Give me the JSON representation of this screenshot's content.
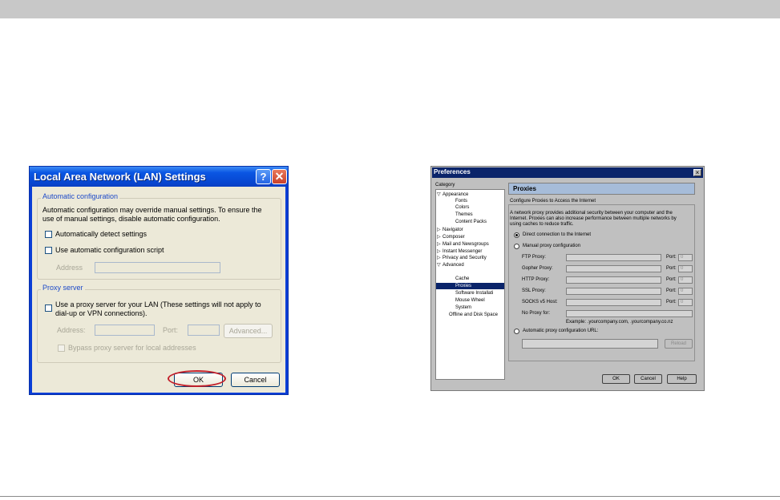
{
  "lan_dialog": {
    "title": "Local Area Network (LAN) Settings",
    "help_glyph": "?",
    "close_glyph": "✕",
    "auto_config": {
      "legend": "Automatic configuration",
      "description_line1": "Automatic configuration may override manual settings.  To ensure the",
      "description_line2": "use of manual settings, disable automatic configuration.",
      "auto_detect_label": "Automatically detect settings",
      "auto_script_label": "Use automatic configuration script",
      "address_label": "Address"
    },
    "proxy": {
      "legend": "Proxy server",
      "use_proxy_line1": "Use a proxy server for your LAN (These settings will not apply to",
      "use_proxy_line2": "dial-up or VPN connections).",
      "address_label": "Address:",
      "port_label": "Port:",
      "advanced_label": "Advanced...",
      "bypass_label": "Bypass proxy server for local addresses"
    },
    "ok_label": "OK",
    "cancel_label": "Cancel"
  },
  "prefs_dialog": {
    "title": "Preferences",
    "close_glyph": "×",
    "category_label": "Category",
    "tree": [
      {
        "label": "Appearance",
        "marker": "▽"
      },
      {
        "label": "Fonts"
      },
      {
        "label": "Colors"
      },
      {
        "label": "Themes"
      },
      {
        "label": "Content Packs"
      },
      {
        "label": "Navigator",
        "marker": "▷"
      },
      {
        "label": "Composer",
        "marker": "▷"
      },
      {
        "label": "Mail and Newsgroups",
        "marker": "▷"
      },
      {
        "label": "Instant Messenger",
        "marker": "▷"
      },
      {
        "label": "Privacy and Security",
        "marker": "▷"
      },
      {
        "label": "Advanced",
        "marker": "▽"
      },
      {
        "label": "Cache"
      },
      {
        "label": "Proxies"
      },
      {
        "label": "Software Installati"
      },
      {
        "label": "Mouse Wheel"
      },
      {
        "label": "System"
      },
      {
        "label": "Offline and Disk Space"
      }
    ],
    "panel_title": "Proxies",
    "group_title": "Configure Proxies to Access the Internet",
    "description_line1": "A network proxy provides additional security between your computer and the",
    "description_line2": "Internet. Proxies can also increase performance between multiple networks by",
    "description_line3": "using caches to reduce traffic.",
    "direct_label": "Direct connection to the Internet",
    "manual_label": "Manual proxy configuration",
    "proxy_rows": [
      {
        "label": "FTP Proxy:",
        "port_label": "Port:",
        "port_value": "0"
      },
      {
        "label": "Gopher Proxy:",
        "port_label": "Port:",
        "port_value": "0"
      },
      {
        "label": "HTTP Proxy:",
        "port_label": "Port:",
        "port_value": "0"
      },
      {
        "label": "SSL Proxy:",
        "port_label": "Port:",
        "port_value": "0"
      },
      {
        "label": "SOCKS v5 Host:",
        "port_label": "Port:",
        "port_value": "0"
      }
    ],
    "no_proxy_label": "No Proxy for:",
    "example_text": "Example: .yourcompany.com, .yourcompany.co.nz",
    "auto_url_label": "Automatic proxy configuration URL:",
    "reload_label": "Reload",
    "ok_label": "OK",
    "cancel_label": "Cancel",
    "help_label": "Help"
  }
}
